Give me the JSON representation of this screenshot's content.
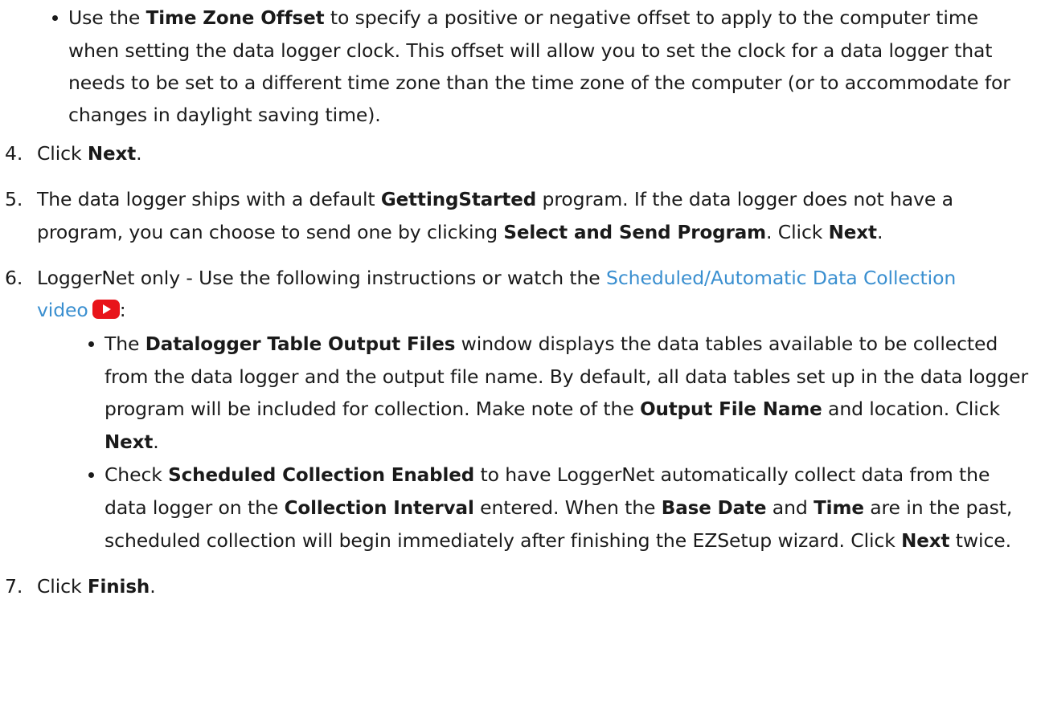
{
  "bullet_time_zone": {
    "t1": "Use the ",
    "b1": "Time Zone Offset",
    "t2": " to specify a positive or negative offset to apply to the computer time when setting the data logger clock. This offset will allow you to set the clock for a data logger that needs to be set to a different time zone than the time zone of the computer (or to accommodate for changes in daylight saving time)."
  },
  "step4": {
    "num": "4.",
    "t1": "Click ",
    "b1": "Next",
    "t2": "."
  },
  "step5": {
    "num": "5.",
    "t1": "The data logger ships with a default ",
    "b1": "GettingStarted",
    "t2": " program. If the data logger does not have a program, you can choose to send one by clicking ",
    "b2": "Select and Send Program",
    "t3": ". Click ",
    "b3": "Next",
    "t4": "."
  },
  "step6": {
    "num": "6.",
    "t1": "LoggerNet only - Use the following instructions or watch the ",
    "link": "Scheduled/Automatic Data Collection video",
    "icon": "youtube-play-icon",
    "t2": ":"
  },
  "bullet_output_files": {
    "t1": "The ",
    "b1": "Datalogger Table Output Files",
    "t2": " window displays the data tables available to be collected from the data logger and the output file name. By default, all data tables set up in the data logger program will be included for collection. Make note of the ",
    "b2": "Output File Name",
    "t3": " and location. Click ",
    "b3": "Next",
    "t4": "."
  },
  "bullet_scheduled": {
    "t1": "Check ",
    "b1": "Scheduled Collection Enabled",
    "t2": " to have LoggerNet automatically collect data from the data logger on the ",
    "b2": "Collection Interval",
    "t3": " entered. When the ",
    "b3": "Base Date",
    "t4": " and ",
    "b4": "Time",
    "t5": " are in the past, scheduled collection will begin immediately after finishing the EZSetup wizard. Click ",
    "b5": "Next",
    "t6": " twice."
  },
  "step7": {
    "num": "7.",
    "t1": "Click ",
    "b1": "Finish",
    "t2": "."
  },
  "colors": {
    "text": "#1a1a1a",
    "link": "#3a8fd0",
    "youtube_red": "#e8141a"
  }
}
